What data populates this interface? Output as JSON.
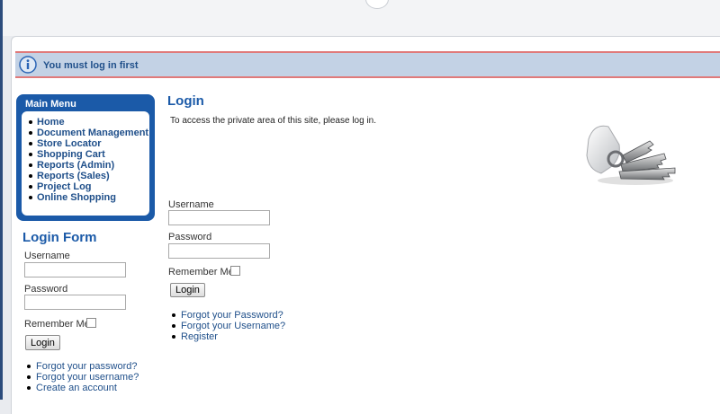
{
  "message": {
    "text": "You must log in first",
    "icon": "info-icon"
  },
  "main_menu": {
    "title": "Main Menu",
    "items": [
      "Home",
      "Document Management",
      "Store Locator",
      "Shopping Cart",
      "Reports (Admin)",
      "Reports (Sales)",
      "Project Log",
      "Online Shopping"
    ]
  },
  "login_form": {
    "title": "Login Form",
    "username_label": "Username",
    "password_label": "Password",
    "remember_label": "Remember Me",
    "button": "Login",
    "links": [
      "Forgot your password?",
      "Forgot your username?",
      "Create an account"
    ]
  },
  "login_main": {
    "title": "Login",
    "intro": "To access the private area of this site, please log in.",
    "username_label": "Username",
    "password_label": "Password",
    "remember_label": "Remember Me",
    "button": "Login",
    "links": [
      "Forgot your Password?",
      "Forgot your Username?",
      "Register"
    ],
    "image": "keys-icon"
  },
  "colors": {
    "accent": "#1b5aa8",
    "link": "#1f4f8a",
    "message_bg": "#c3d2e5",
    "message_border": "#e07a7a"
  }
}
